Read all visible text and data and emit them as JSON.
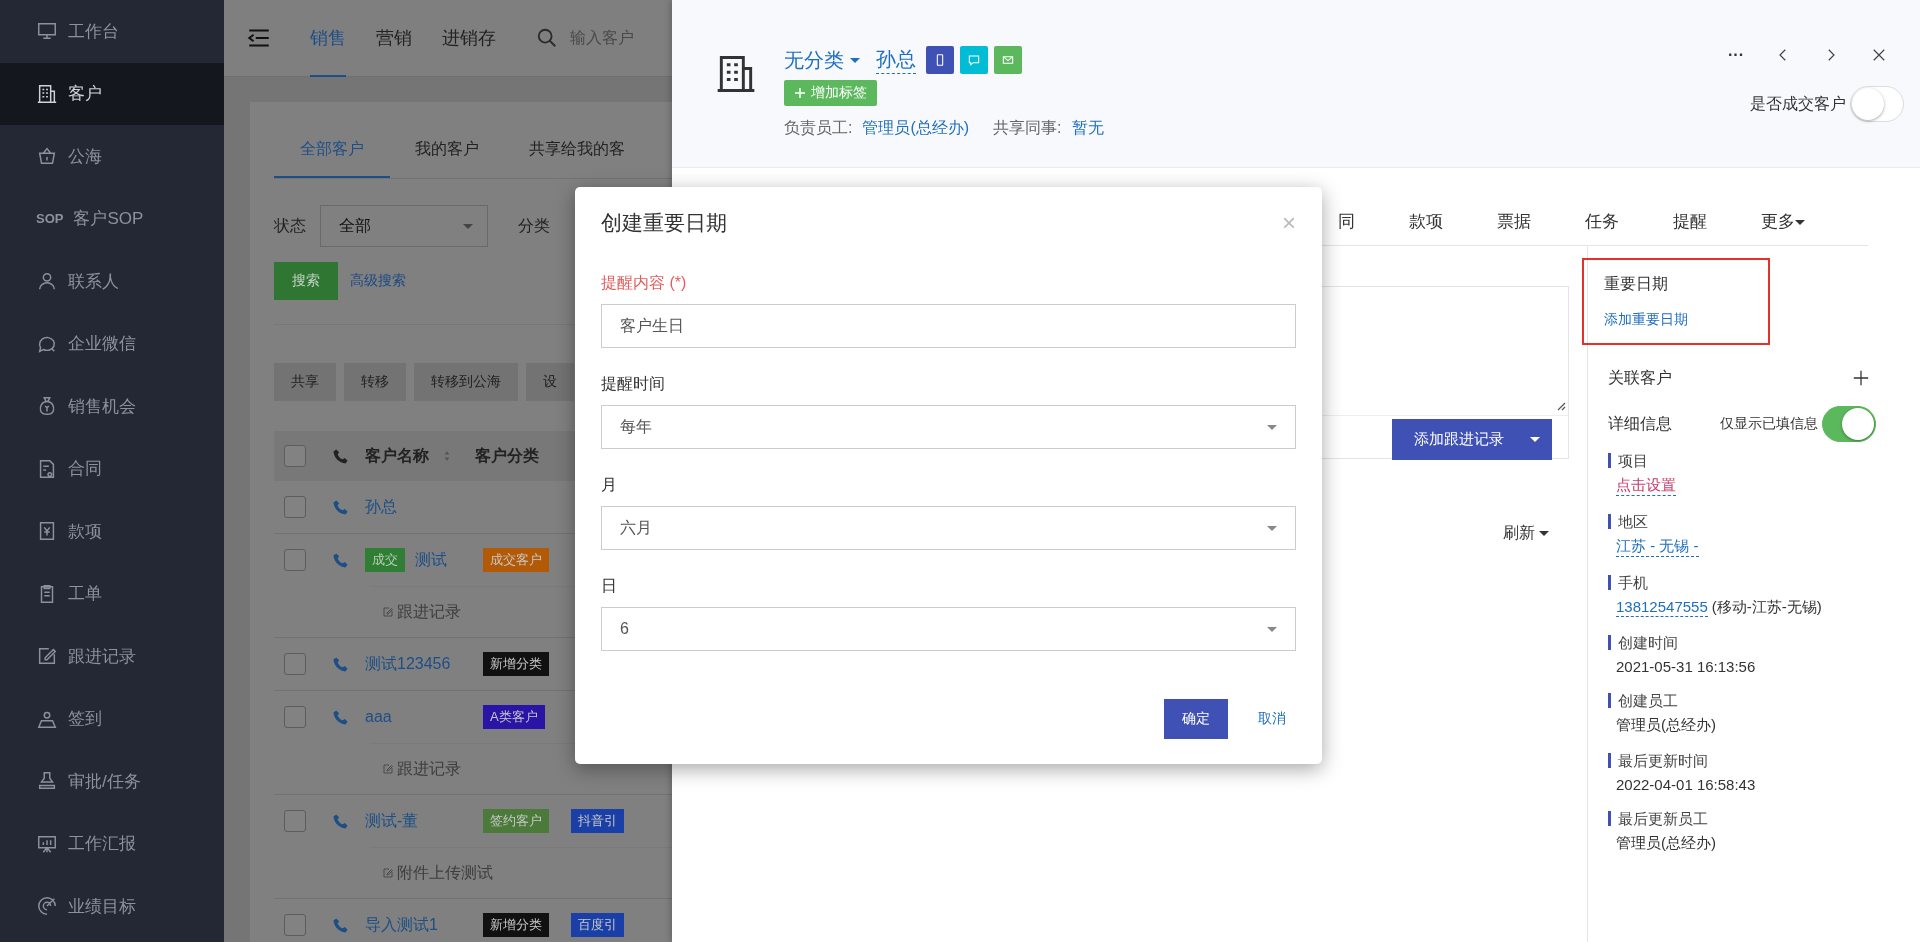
{
  "sidebar": {
    "items": [
      {
        "label": "工作台",
        "selected": false
      },
      {
        "label": "客户",
        "selected": true
      },
      {
        "label": "公海",
        "selected": false
      },
      {
        "label": "客户SOP",
        "badge": "SOP",
        "selected": false
      },
      {
        "label": "联系人",
        "selected": false
      },
      {
        "label": "企业微信",
        "selected": false
      },
      {
        "label": "销售机会",
        "selected": false
      },
      {
        "label": "合同",
        "selected": false
      },
      {
        "label": "款项",
        "selected": false
      },
      {
        "label": "工单",
        "selected": false
      },
      {
        "label": "跟进记录",
        "selected": false
      },
      {
        "label": "签到",
        "selected": false
      },
      {
        "label": "审批/任务",
        "selected": false
      },
      {
        "label": "工作汇报",
        "selected": false
      },
      {
        "label": "业绩目标",
        "selected": false
      }
    ]
  },
  "top_nav": {
    "tabs": [
      {
        "label": "销售",
        "selected": true
      },
      {
        "label": "营销",
        "selected": false
      },
      {
        "label": "进销存",
        "selected": false
      }
    ],
    "search": {
      "placeholder": "输入客户"
    }
  },
  "customer_list": {
    "tabs": [
      {
        "label": "全部客户",
        "selected": true
      },
      {
        "label": "我的客户",
        "selected": false
      },
      {
        "label": "共享给我的客",
        "selected": false
      }
    ],
    "status_filter": {
      "label": "状态",
      "value": "全部"
    },
    "category_label": "分类",
    "search_button": "搜索",
    "advanced_search": "高级搜索",
    "actions": [
      "共享",
      "转移",
      "转移到公海",
      "设"
    ],
    "columns": [
      "客户名称",
      "客户分类"
    ],
    "all_checked": false,
    "rows": [
      {
        "name": "孙总",
        "checked": false,
        "tags": []
      },
      {
        "status_tag": "成交",
        "name": "测试",
        "checked": false,
        "tags": [
          {
            "label": "成交客户",
            "color": "#b35a08"
          }
        ],
        "note": "跟进记录"
      },
      {
        "name": "测试123456",
        "checked": false,
        "tags": [
          {
            "label": "新增分类",
            "color": "#111111"
          }
        ]
      },
      {
        "name": "aaa",
        "checked": false,
        "tags": [
          {
            "label": "A类客户",
            "color": "#2a14a6"
          }
        ],
        "note": "跟进记录"
      },
      {
        "name": "测试-董",
        "checked": false,
        "tags": [
          {
            "label": "签约客户",
            "color": "#4c7a3a"
          },
          {
            "label": "抖音引",
            "color": "#1a3fa6"
          }
        ],
        "note": "附件上传测试"
      },
      {
        "name": "导入测试1",
        "checked": false,
        "tags": [
          {
            "label": "新增分类",
            "color": "#111111"
          },
          {
            "label": "百度引",
            "color": "#1a3fa6"
          }
        ]
      }
    ]
  },
  "customer": {
    "category": "无分类",
    "name": "孙总",
    "tag_button": "增加标签",
    "owner_label": "负责员工:",
    "owner": "管理员(总经办)",
    "shared_label": "共享同事:",
    "shared": "暂无",
    "more": "···",
    "deal_label": "是否成交客户",
    "deal": false
  },
  "tabs": [
    {
      "label": "同",
      "selected": false
    },
    {
      "label": "款项",
      "selected": false
    },
    {
      "label": "票据",
      "selected": false
    },
    {
      "label": "任务",
      "selected": false
    },
    {
      "label": "提醒",
      "selected": false
    },
    {
      "label": "更多",
      "selected": false
    }
  ],
  "followup": {
    "add_button": "添加跟进记录",
    "refresh": "刷新"
  },
  "side": {
    "important_dates": {
      "title": "重要日期",
      "add_link": "添加重要日期",
      "highlighted": true
    },
    "related": {
      "title": "关联客户"
    },
    "details": {
      "title": "详细信息",
      "filled_only_label": "仅显示已填信息",
      "filled_only": true,
      "fields": [
        {
          "label": "项目",
          "value": "点击设置",
          "kind": "action"
        },
        {
          "label": "地区",
          "value": "江苏 - 无锡 -",
          "kind": "link"
        },
        {
          "label": "手机",
          "value": "13812547555",
          "extra": "(移动-江苏-无锡)",
          "kind": "link"
        },
        {
          "label": "创建时间",
          "value": "2021-05-31 16:13:56",
          "kind": "text"
        },
        {
          "label": "创建员工",
          "value": "管理员(总经办)",
          "kind": "text"
        },
        {
          "label": "最后更新时间",
          "value": "2022-04-01 16:58:43",
          "kind": "text"
        },
        {
          "label": "最后更新员工",
          "value": "管理员(总经办)",
          "kind": "text"
        }
      ]
    }
  },
  "dialog": {
    "title": "创建重要日期",
    "close": "×",
    "fields": [
      {
        "label": "提醒内容 (*)",
        "required": true,
        "kind": "input",
        "value": "客户生日"
      },
      {
        "label": "提醒时间",
        "required": false,
        "kind": "select",
        "value": "每年"
      },
      {
        "label": "月",
        "required": false,
        "kind": "select",
        "value": "六月"
      },
      {
        "label": "日",
        "required": false,
        "kind": "select",
        "value": "6"
      }
    ],
    "confirm": "确定",
    "cancel": "取消"
  }
}
